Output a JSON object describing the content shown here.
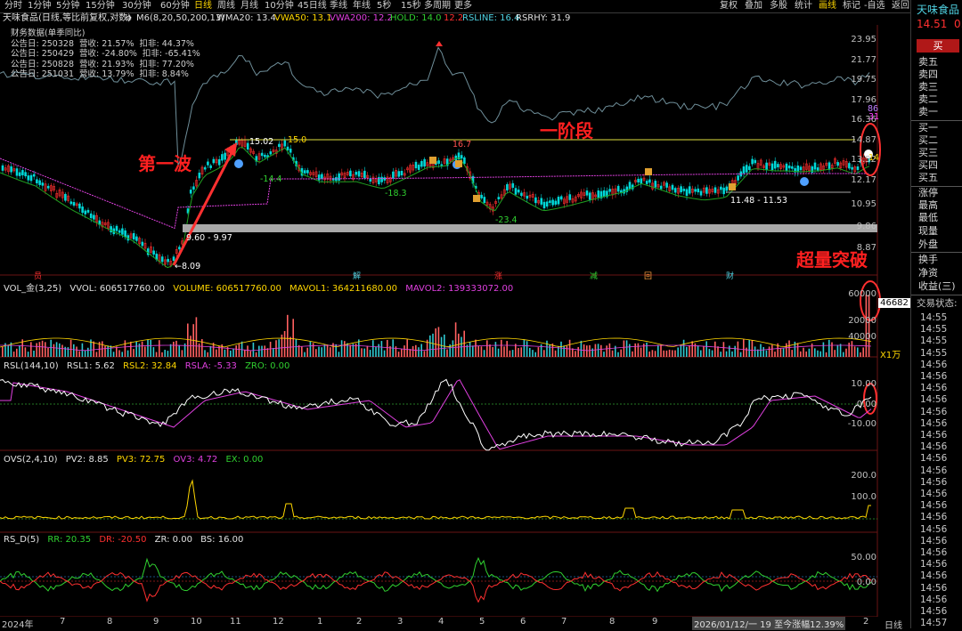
{
  "periods": [
    "分时",
    "1分钟",
    "5分钟",
    "15分钟",
    "30分钟",
    "60分钟",
    "日线",
    "周线",
    "月线",
    "10分钟",
    "45日线",
    "季线",
    "年线",
    "5秒",
    "15秒",
    "多周期",
    "更多"
  ],
  "active_period": "日线",
  "top_right": [
    "复权",
    "叠加",
    "多股",
    "统计",
    "画线",
    "标记",
    "-自选",
    "返回"
  ],
  "stock": {
    "name_info": "天味食品(日线,等比前复权,对数)",
    "m6": "M6(8,20,50,200,13)",
    "wma20": "WMA20: 13.4",
    "vwa50": "VWA50: 13.1",
    "vwa200": "VWA200: 12.2",
    "hold": "HOLD: 14.0",
    "hold_val": "12.2",
    "rsline": "RSLINE: 16.4",
    "rsrhy": "RSRHY: 31.9"
  },
  "fin": {
    "title": "财务数据(单季同比)",
    "rows": [
      "公告日: 250328  营收: 21.57%  扣非: 44.37%",
      "公告日: 250429  营收: -24.80%  扣非: -65.41%",
      "公告日: 250828  营收: 21.93%  扣非: 77.20%",
      "公告日: 251031  营收: 13.79%  扣非: 8.84%"
    ]
  },
  "price_axis": [
    "23.95",
    "21.77",
    "19.75",
    "17.96",
    "16.36",
    "14.87",
    "13.52",
    "12.17",
    "10.95",
    "9.86",
    "8.87"
  ],
  "price_labels": {
    "high1": "15.02",
    "high2": "15.0",
    "peak": "16.7",
    "low1": "-14.4",
    "low2": "-18.3",
    "low3": "-23.4",
    "range1": "11.48 - 11.53",
    "range2": "9.60 - 9.97",
    "bottom": "8.09",
    "v86": "86",
    "v31": "31",
    "v14": "14"
  },
  "annotations": {
    "wave1": "第一波",
    "stage1": "一阶段",
    "breakout": "超量突破"
  },
  "event_markers": [
    "员",
    "解",
    "涨",
    "减",
    "回",
    "财"
  ],
  "vol": {
    "name": "VOL_金(3,25)",
    "vvol": "VVOL: 606517760.00",
    "volume": "VOLUME: 606517760.00",
    "mavol1": "MAVOL1: 364211680.00",
    "mavol2": "MAVOL2: 139333072.00",
    "axis": [
      "60000",
      "40000",
      "20000"
    ],
    "current": "46682",
    "unit": "X1万"
  },
  "rsl": {
    "name": "RSL(144,10)",
    "rsl1": "RSL1: 5.62",
    "rsl2": "RSL2: 32.84",
    "rsla": "RSLA: -5.33",
    "zro": "ZRO: 0.00",
    "axis": [
      "10.00",
      "0.00",
      "-10.00"
    ]
  },
  "ovs": {
    "name": "OVS(2,4,10)",
    "pv2": "PV2: 8.85",
    "pv3": "PV3: 72.75",
    "ov3": "OV3: 4.72",
    "ex": "EX: 0.00",
    "axis": [
      "200.0",
      "100.0"
    ]
  },
  "rsd": {
    "name": "RS_D(5)",
    "rr": "RR: 20.35",
    "dr": "DR: -20.50",
    "zr": "ZR: 0.00",
    "bs": "BS: 16.00",
    "axis": [
      "50.00",
      "0.00"
    ]
  },
  "bottom": {
    "year": "2024年",
    "months": [
      "7",
      "8",
      "9",
      "10",
      "11",
      "12",
      "1",
      "2",
      "3",
      "4",
      "5",
      "6",
      "7",
      "8",
      "9",
      "2"
    ],
    "range_info": "2026/01/12/一 19 至今涨幅12.39%",
    "mode": "日线"
  },
  "right": {
    "name": "天味食品",
    "price": "14.51",
    "change": "0.",
    "buy_btn": "买",
    "orderbook": [
      "卖五",
      "卖四",
      "卖三",
      "卖二",
      "卖一",
      "买一",
      "买二",
      "买三",
      "买四",
      "买五"
    ],
    "stats": [
      "涨停",
      "最高",
      "最低",
      "现量",
      "外盘",
      "换手",
      "净资",
      "收益(三)"
    ],
    "status": "交易状态:",
    "times": [
      "14:55",
      "14:55",
      "14:55",
      "14:55",
      "14:56",
      "14:56",
      "14:56",
      "14:56",
      "14:56",
      "14:56",
      "14:56",
      "14:56",
      "14:56",
      "14:56",
      "14:56",
      "14:56",
      "14:56",
      "14:56",
      "14:56",
      "14:56",
      "14:56",
      "14:56",
      "14:56",
      "14:56",
      "14:56",
      "14:56",
      "14:57"
    ]
  },
  "colors": {
    "up": "#ff3030",
    "down": "#00d8d8",
    "yellow": "#ffd700",
    "magenta": "#e040e0",
    "green": "#30d030",
    "white": "#ffffff",
    "cyan": "#4fd0e0"
  }
}
